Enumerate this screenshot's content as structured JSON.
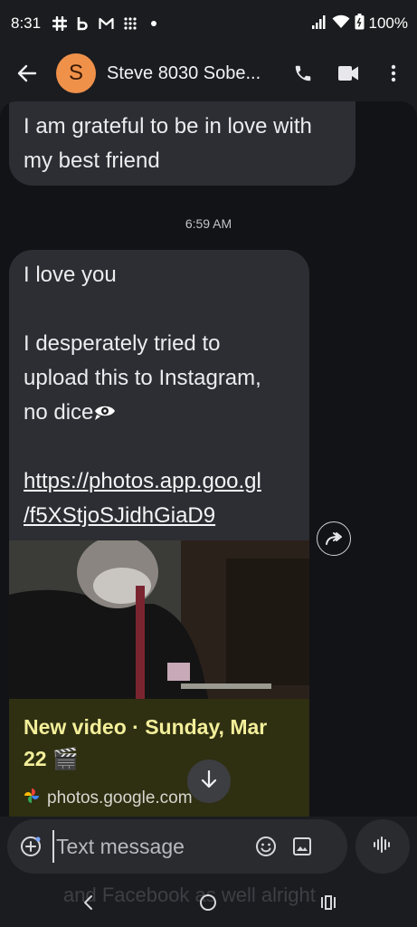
{
  "status_bar": {
    "time": "8:31",
    "battery": "100%"
  },
  "header": {
    "avatar_letter": "S",
    "contact_name": "Steve 8030 Sobe...",
    "avatar_color": "#f0914a"
  },
  "messages": {
    "incoming_1": {
      "line1": "I am grateful to be in love with",
      "line2": "my best friend"
    },
    "timestamp": "6:59 AM",
    "incoming_2": {
      "line1": "I love you",
      "line2": "I desperately tried to",
      "line3": "upload this to Instagram,",
      "line4": "no dice",
      "link_line1": "https://photos.app.goo.gl",
      "link_line2": "/f5XStjoSJidhGiaD9"
    },
    "link_preview": {
      "title_line1": "New video · Sunday, Mar",
      "title_line2": "22 🎬",
      "source": "photos.google.com"
    }
  },
  "compose": {
    "placeholder": "Text message"
  },
  "background_peek": {
    "text": "and Facebook as well alright"
  },
  "icons": [
    "slack-icon",
    "b-icon",
    "gmail-icon",
    "grid-icon",
    "signal-icon",
    "wifi-icon",
    "battery-icon",
    "back-arrow-icon",
    "phone-icon",
    "video-icon",
    "more-vert-icon",
    "forward-icon",
    "arrow-down-icon",
    "add-icon",
    "emoji-icon",
    "gallery-icon",
    "voice-icon",
    "nav-back-icon",
    "nav-home-icon",
    "nav-recents-icon"
  ]
}
